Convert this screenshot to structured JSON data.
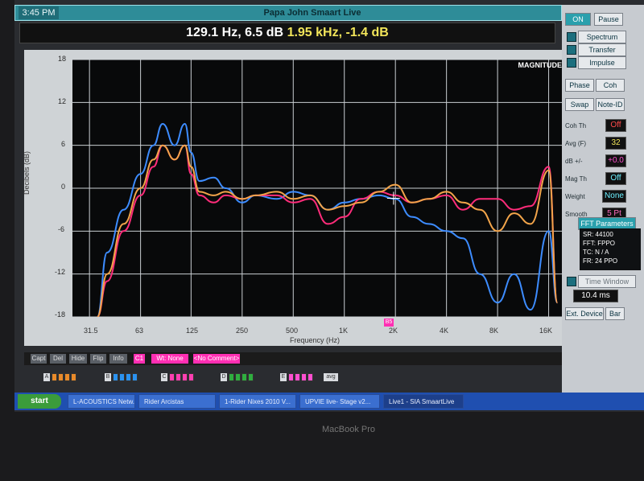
{
  "clock": "3:45 PM",
  "app_title": "Papa John Smaart Live",
  "readout": {
    "left": "129.1 Hz, 6.5 dB",
    "right": "1.95 kHz, -1.4 dB"
  },
  "plot": {
    "label": "MAGNITUDE",
    "ylabel": "Decibels (dB)",
    "xlabel": "Frequency (Hz)",
    "marker": "B5"
  },
  "right_panel": {
    "on": "ON",
    "pause": "Pause",
    "spectrum": "Spectrum",
    "transfer": "Transfer",
    "impulse": "Impulse",
    "phase": "Phase",
    "coh": "Coh",
    "swap": "Swap",
    "note_id": "Note-ID",
    "coh_th_label": "Coh Th",
    "coh_th_value": "Off",
    "avg_label": "Avg (F)",
    "avg_value": "32",
    "db_label": "dB +/-",
    "db_value": "+0.0",
    "mag_th_label": "Mag Th",
    "mag_th_value": "Off",
    "weight_label": "Weight",
    "weight_value": "None",
    "smooth_label": "Smooth",
    "smooth_value": "5 Pt",
    "fft_params": "FFT Parameters",
    "sr": "SR: 44100",
    "fft": "FFT: FPPO",
    "tc": "TC: N / A",
    "fr": "FR: 24 PPO",
    "time_window": "Time Window",
    "time_value": "10.4 ms",
    "ext_device": "Ext. Device",
    "bar": "Bar"
  },
  "bottom_toolbar": {
    "capt": "Capt",
    "del": "Del",
    "hide": "Hide",
    "flip": "Flip",
    "info": "Info",
    "c1": "C1",
    "wt": "Wt: None",
    "comment": "<No Comment>"
  },
  "trace_letters": [
    "A",
    "B",
    "C",
    "D",
    "E"
  ],
  "avg_button": "avg",
  "taskbar": {
    "start": "start",
    "items": [
      "L-ACOUSTICS Netw...",
      "Rider Arcistas",
      "1-Rider Nixes 2010 V...",
      "UPVIE live- Stage v2...",
      "Live1 - SIA SmaartLive"
    ]
  },
  "brand": "MacBook Pro",
  "chart_data": {
    "type": "line",
    "x_scale": "log",
    "xlim": [
      25,
      20000
    ],
    "ylim": [
      -18,
      18
    ],
    "ylabel": "Decibels (dB)",
    "xlabel": "Frequency (Hz)",
    "x_ticks": [
      "31.5",
      "63",
      "125",
      "250",
      "500",
      "1K",
      "2K",
      "4K",
      "8K",
      "16K"
    ],
    "y_ticks": [
      "18",
      "12",
      "6",
      "0",
      "-6",
      "-12",
      "-18"
    ],
    "series": [
      {
        "color": "#3d8cff",
        "x": [
          35,
          40,
          50,
          63,
          75,
          85,
          100,
          115,
          125,
          140,
          170,
          200,
          250,
          300,
          400,
          500,
          630,
          800,
          1000,
          1250,
          1600,
          2000,
          2500,
          3150,
          4000,
          5000,
          6300,
          8000,
          10000,
          12500,
          16000,
          18000
        ],
        "y": [
          -18,
          -9,
          -3,
          2,
          6,
          9,
          6,
          9,
          5,
          1,
          1.5,
          0,
          -2,
          -1,
          -1.5,
          -0.5,
          -1,
          -3,
          -2,
          -1.5,
          -1,
          -1.5,
          -4,
          -5,
          -6,
          -7,
          -12,
          -16,
          -12,
          -17,
          -6,
          -16
        ]
      },
      {
        "color": "#ff2c7a",
        "x": [
          35,
          40,
          50,
          63,
          75,
          85,
          100,
          115,
          125,
          140,
          170,
          200,
          250,
          300,
          400,
          500,
          630,
          800,
          1000,
          1250,
          1600,
          2000,
          2500,
          3150,
          4000,
          5000,
          6300,
          8000,
          10000,
          12500,
          16000,
          18000
        ],
        "y": [
          -18,
          -13,
          -6,
          -1,
          3,
          6,
          4,
          6,
          2,
          -1,
          -2,
          -1,
          -1.5,
          -1,
          -1,
          -2,
          -1.5,
          -5,
          -4,
          -1.5,
          -0.5,
          -1,
          -2,
          -1.5,
          -1,
          -3,
          -1.5,
          -1.5,
          -3,
          -2.5,
          3,
          -16
        ]
      },
      {
        "color": "#f2a44a",
        "x": [
          35,
          40,
          50,
          63,
          75,
          85,
          100,
          115,
          125,
          140,
          170,
          200,
          250,
          300,
          400,
          500,
          630,
          800,
          1000,
          1250,
          1600,
          2000,
          2500,
          3150,
          4000,
          5000,
          6300,
          8000,
          10000,
          12500,
          16000,
          18000
        ],
        "y": [
          -18,
          -12,
          -5,
          0,
          4,
          6,
          4,
          6,
          3,
          -0.5,
          -1,
          -0.5,
          -1.5,
          -1,
          -0.5,
          -1.5,
          -1,
          -3,
          -2.5,
          -2,
          -0.5,
          0.5,
          -2,
          -1.5,
          -0.5,
          -2,
          -3,
          -6,
          -3.5,
          -5,
          2.5,
          -16
        ]
      }
    ]
  }
}
